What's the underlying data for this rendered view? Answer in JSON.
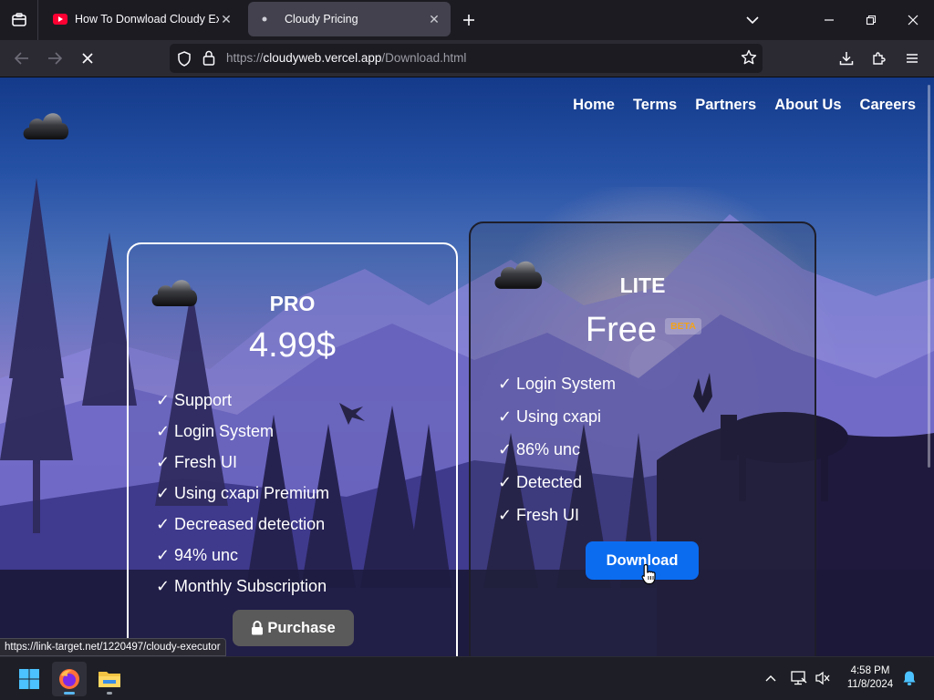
{
  "browser": {
    "tabs": [
      {
        "title": "How To Donwload Cloudy Exec",
        "active": false,
        "favicon": "youtube-icon"
      },
      {
        "title": "Cloudy Pricing",
        "active": true,
        "favicon": "dot-icon"
      }
    ],
    "url_scheme": "https://",
    "url_host": "cloudyweb.vercel.app",
    "url_path": "/Download.html"
  },
  "site": {
    "nav": [
      "Home",
      "Terms",
      "Partners",
      "About Us",
      "Careers"
    ]
  },
  "plans": {
    "pro": {
      "name": "PRO",
      "price": "4.99$",
      "features": [
        "Support",
        "Login System",
        "Fresh UI",
        "Using cxapi Premium",
        "Decreased detection",
        "94% unc",
        "Monthly Subscription"
      ],
      "button": "Purchase"
    },
    "lite": {
      "name": "LITE",
      "price": "Free",
      "badge": "BETA",
      "features": [
        "Login System",
        "Using cxapi",
        "86% unc",
        "Detected",
        "Fresh UI"
      ],
      "button": "Download"
    }
  },
  "check_glyph": "✓",
  "status_link": "https://link-target.net/1220497/cloudy-executor",
  "taskbar": {
    "time": "4:58 PM",
    "date": "11/8/2024"
  },
  "colors": {
    "download_button": "#0b6cf0",
    "purchase_button": "#5a5a5a",
    "beta_text": "#f2a21b",
    "browser_bg": "#1c1b22"
  }
}
